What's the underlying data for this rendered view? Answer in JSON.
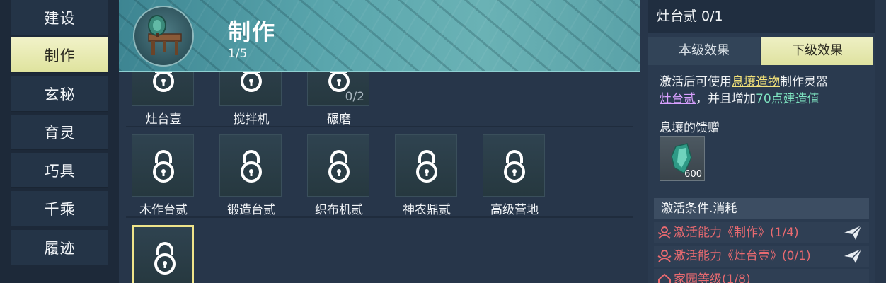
{
  "nav": {
    "items": [
      {
        "label": "建设",
        "active": false
      },
      {
        "label": "制作",
        "active": true
      },
      {
        "label": "玄秘",
        "active": false
      },
      {
        "label": "育灵",
        "active": false
      },
      {
        "label": "巧具",
        "active": false
      },
      {
        "label": "千乘",
        "active": false
      },
      {
        "label": "履迹",
        "active": false
      }
    ]
  },
  "banner": {
    "title": "制作",
    "progress": "1/5"
  },
  "grid": {
    "row1": [
      {
        "label": "灶台壹",
        "count": ""
      },
      {
        "label": "搅拌机",
        "count": ""
      },
      {
        "label": "碾磨",
        "count": "0/2"
      }
    ],
    "row2": [
      {
        "label": "木作台贰"
      },
      {
        "label": "锻造台贰"
      },
      {
        "label": "织布机贰"
      },
      {
        "label": "神农鼎贰"
      },
      {
        "label": "高级营地"
      }
    ],
    "row3": [
      {
        "label": ""
      }
    ]
  },
  "panel": {
    "title": "灶台贰 0/1",
    "tabs": [
      "本级效果",
      "下级效果"
    ],
    "desc": {
      "p1": "激活后可使用",
      "link1": "息壤造物",
      "p2": "制作灵器",
      "link2": "灶台贰",
      "p3": "，并且增加",
      "value": "70点建造值"
    },
    "gift_title": "息壤的馈赠",
    "gift_count": "600",
    "cond_header": "激活条件.消耗",
    "conditions": [
      "激活能力《制作》(1/4)",
      "激活能力《灶台壹》(0/1)",
      "家园等级(1/8)"
    ]
  },
  "colors": {
    "accent_yellow": "#efe48a",
    "condition_red": "#e86a70",
    "highlight_green": "#7fe6c2",
    "highlight_purple": "#d9a0ff"
  }
}
